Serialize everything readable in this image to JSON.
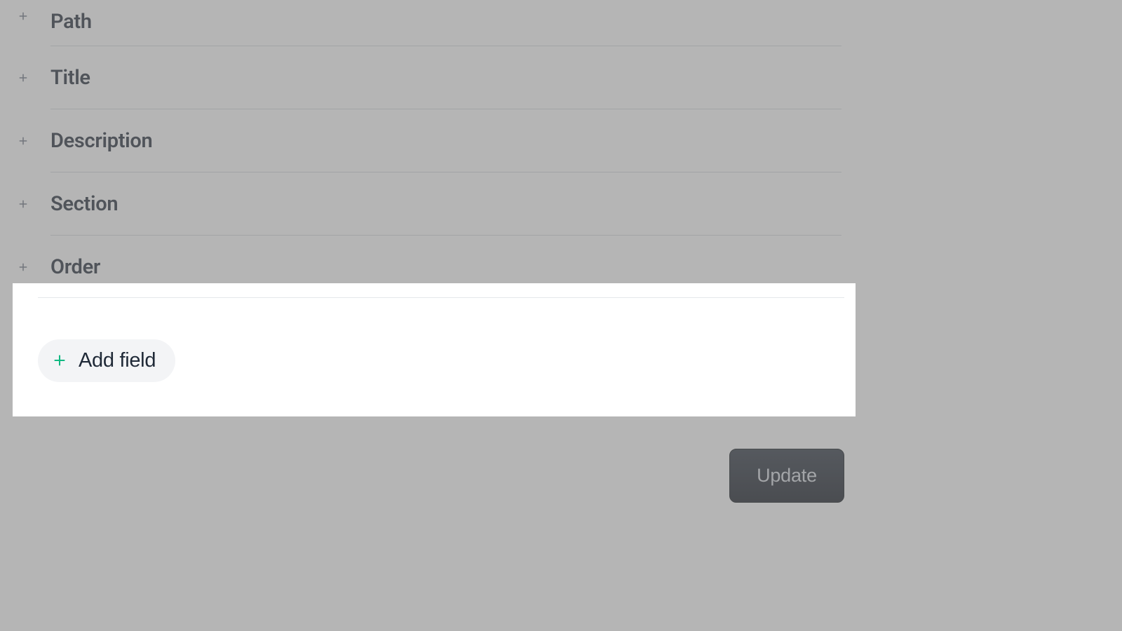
{
  "fields": [
    {
      "label": "Path"
    },
    {
      "label": "Title"
    },
    {
      "label": "Description"
    },
    {
      "label": "Section"
    },
    {
      "label": "Order"
    }
  ],
  "add_field": {
    "label": "Add field"
  },
  "update_button": {
    "label": "Update"
  }
}
